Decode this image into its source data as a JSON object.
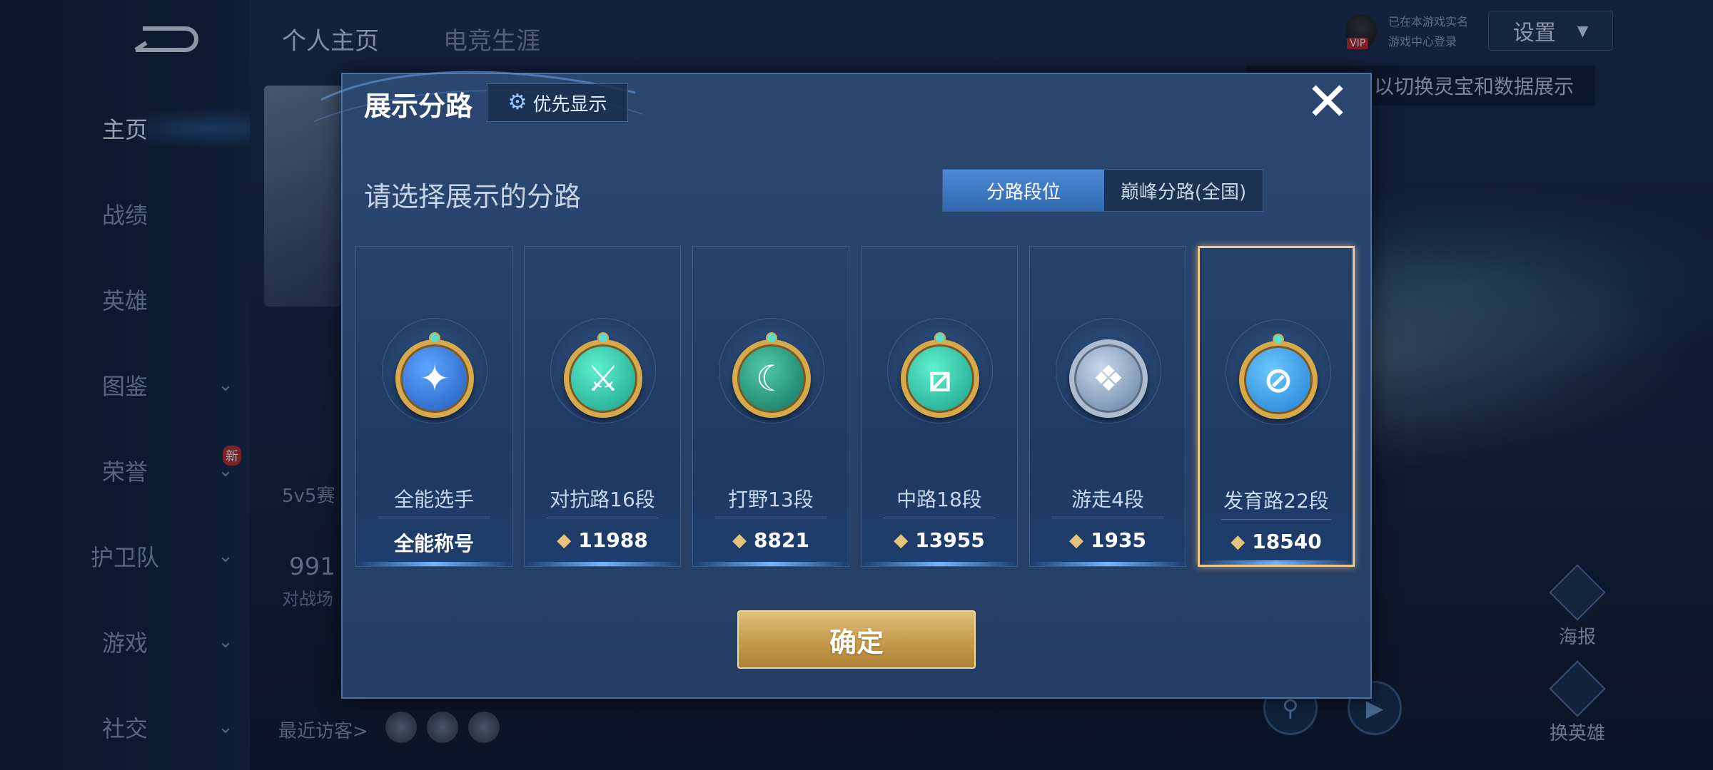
{
  "sidebar": {
    "items": [
      {
        "label": "主页",
        "active": true,
        "chevron": false
      },
      {
        "label": "战绩",
        "active": false,
        "chevron": false
      },
      {
        "label": "英雄",
        "active": false,
        "chevron": false
      },
      {
        "label": "图鉴",
        "active": false,
        "chevron": true
      },
      {
        "label": "荣誉",
        "active": false,
        "chevron": true,
        "badge": "新"
      },
      {
        "label": "护卫队",
        "active": false,
        "chevron": true
      },
      {
        "label": "游戏",
        "active": false,
        "chevron": true
      },
      {
        "label": "社交",
        "active": false,
        "chevron": true
      }
    ]
  },
  "top_tabs": [
    "个人主页",
    "电竞生涯"
  ],
  "header": {
    "settings_label": "设置",
    "tooltip": "以切换灵宝和数据展示",
    "vip_tag": "VIP",
    "vip_line1": "已在本游戏实名",
    "vip_line2": "游戏中心登录"
  },
  "background": {
    "rank_label": "5v5赛",
    "score": "991",
    "score_label": "对战场",
    "visitors_label": "最近访客>",
    "right_controls": [
      "海报",
      "换英雄"
    ]
  },
  "modal": {
    "title": "展示分路",
    "priority_button": "优先显示",
    "subtitle": "请选择展示的分路",
    "toggle": {
      "selected": "分路段位",
      "other": "巅峰分路(全国)"
    },
    "cards": [
      {
        "label": "全能选手",
        "value": "全能称号",
        "show_points": false,
        "icon": "all-round-badge-icon",
        "selected": false
      },
      {
        "label": "对抗路16段",
        "value": "11988",
        "show_points": true,
        "icon": "clash-lane-badge-icon",
        "selected": false
      },
      {
        "label": "打野13段",
        "value": "8821",
        "show_points": true,
        "icon": "jungle-badge-icon",
        "selected": false
      },
      {
        "label": "中路18段",
        "value": "13955",
        "show_points": true,
        "icon": "mid-lane-badge-icon",
        "selected": false
      },
      {
        "label": "游走4段",
        "value": "1935",
        "show_points": true,
        "icon": "roam-badge-icon",
        "selected": false
      },
      {
        "label": "发育路22段",
        "value": "18540",
        "show_points": true,
        "icon": "farm-lane-badge-icon",
        "selected": true
      }
    ],
    "confirm_label": "确定"
  },
  "colors": {
    "accent_blue": "#2f68b0",
    "gold": "#d8a94a",
    "selected_border": "#f2c88a"
  }
}
